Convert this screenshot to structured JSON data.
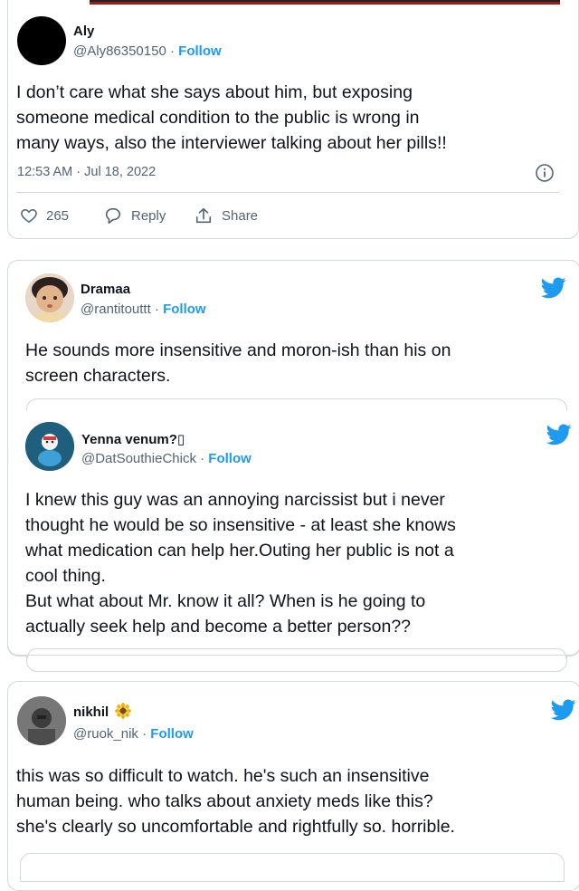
{
  "colors": {
    "follow_blue": "#1d9bf0",
    "text": "#0f1419",
    "muted": "#536471",
    "border": "#cfd9de"
  },
  "tweet1": {
    "name": "Aly",
    "handle": "@Aly86350150",
    "sep": " · ",
    "follow": "Follow",
    "lines": [
      "I don’t care what she says about him, but exposing",
      "someone medical condition to the public is wrong in",
      "many ways, also the interviewer talking about her pills!!"
    ],
    "timestamp": "12:53 AM · Jul 18, 2022",
    "likes": "265",
    "reply_label": "Reply",
    "share_label": "Share",
    "icons": [
      "info-icon",
      "heart-icon",
      "reply-icon",
      "share-icon"
    ]
  },
  "tweet2": {
    "name": "Dramaa",
    "handle": "@rantitouttt",
    "sep": " · ",
    "follow": "Follow",
    "lines": [
      "He sounds more insensitive and moron-ish than his on",
      "screen characters."
    ],
    "icons": [
      "twitter-bird-icon"
    ]
  },
  "quoted": {
    "name": "Yenna venum?▯",
    "handle": "@DatSouthieChick",
    "sep": " · ",
    "follow": "Follow",
    "lines": [
      "I knew this guy was an annoying narcissist but i never",
      "thought he would be so insensitive - at least she knows",
      "what medication can help her.Outing her public is not a",
      "cool thing.",
      "But what about Mr. know it all? When is he going to",
      "actually seek help and become a better person??"
    ],
    "icons": [
      "twitter-bird-icon"
    ]
  },
  "tweet3": {
    "name": "nikhil",
    "name_emoji": "🌻",
    "handle": "@ruok_nik",
    "sep": " · ",
    "follow": "Follow",
    "lines": [
      "this was so difficult to watch. he's such an insensitive",
      "human being. who talks about anxiety meds like this?",
      "she's clearly so uncomfortable and rightfully so. horrible."
    ],
    "icons": [
      "twitter-bird-icon"
    ]
  }
}
